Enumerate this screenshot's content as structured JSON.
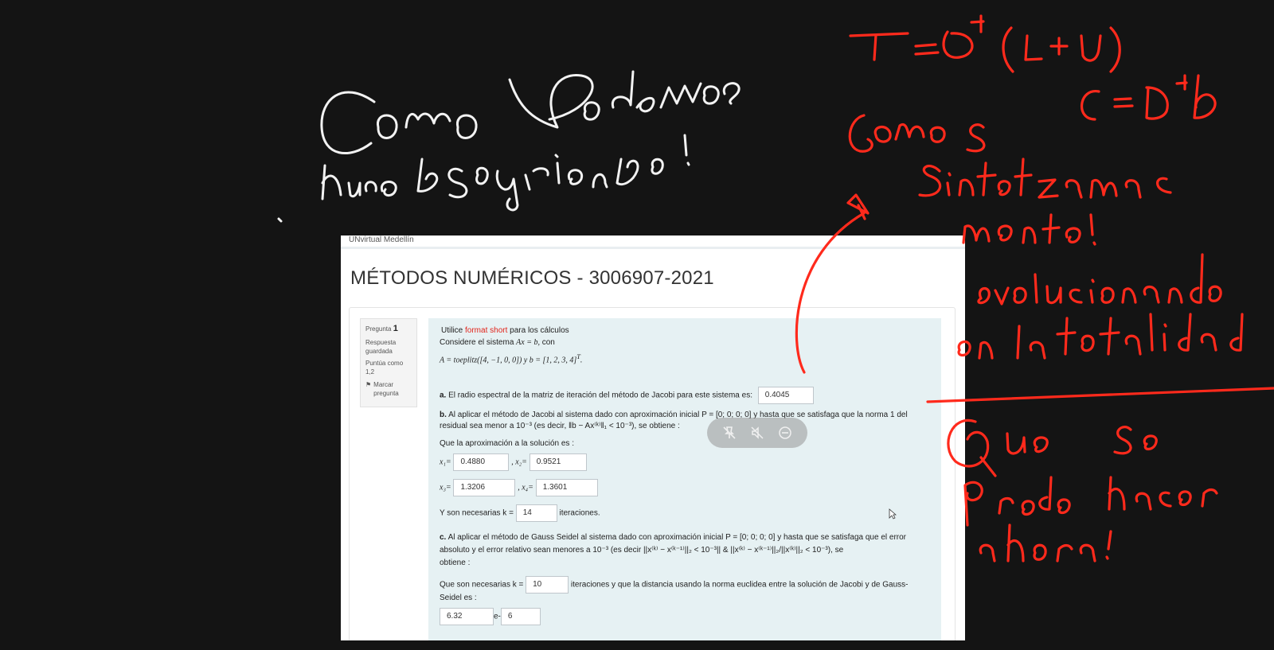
{
  "site_name": "UNvirtual Medellín",
  "course_title": "MÉTODOS NUMÉRICOS - 3006907-2021",
  "question_info": {
    "label": "Pregunta",
    "number": "1",
    "status": "Respuesta guardada",
    "score": "Puntúa como 1,2",
    "flag_label": "Marcar pregunta"
  },
  "question": {
    "intro_prefix": "Utilice",
    "intro_highlight": "format short",
    "intro_suffix": "para los cálculos",
    "system_prefix": "Considere el sistema",
    "system_eq": "Ax = b,",
    "system_suffix": "con",
    "matrix_text": "A = toeplitz([4,    −1,    0,    0]) y b = [1, 2, 3, 4]",
    "part_a_label": "a.",
    "part_a_text": "El radio espectral de la matriz de iteración del método de Jacobi para este sistema es:",
    "part_a_value": "0.4045",
    "part_b_label": "b.",
    "part_b_text1": "Al aplicar el método de Jacobi al sistema dado con aproximación inicial P = [0; 0; 0; 0] y hasta que se satisfaga que la norma 1 del",
    "part_b_text2": "residual sea menor a 10⁻³ (es decir, ‖b − Ax⁽ᵏ⁾‖₁ < 10⁻³), se obtiene :",
    "approx_label": "Que la aproximación a la solución es :",
    "x1_label": "x₁=",
    "x1_value": "0.4880",
    "x2_label": ", x₂=",
    "x2_value": "0.9521",
    "x3_label": "x₃=",
    "x3_value": "1.3206",
    "x4_label": ", x₄=",
    "x4_value": "1.3601",
    "k_prefix": "Y son necesarias k =",
    "k_value": "14",
    "k_suffix": "iteraciones.",
    "part_c_label": "c.",
    "part_c_text1": "Al aplicar el método de Gauss Seidel al sistema dado con aproximación inicial P = [0; 0; 0; 0] y hasta que se satisfaga que el error",
    "part_c_text2": "absoluto y el error relativo sean menores a 10⁻³ (es decir ||x⁽ᵏ⁾ − x⁽ᵏ⁻¹⁾||₂ < 10⁻³|| & ||x⁽ᵏ⁾ − x⁽ᵏ⁻¹⁾||₂/||x⁽ᵏ⁾||₂ < 10⁻³), se",
    "part_c_text3": "obtiene :",
    "gs_k_prefix": "Que son necesarias k =",
    "gs_k_value": "10",
    "gs_k_suffix": "iteraciones y que la distancia usando la norma euclidea entre la solución de Jacobi y de Gauss-",
    "gs_k_suffix2": "Seidel es :",
    "dist_mantissa": "6.32",
    "dist_e": "e-",
    "dist_exp": "6"
  },
  "annotations": {
    "white_note_line1": "Como Podemos",
    "white_note_line2": "hacer lo siguiente!",
    "red_formula": "T = D⁻¹(L+U)",
    "red_line2": "Como se   C = D⁻¹b",
    "red_line3": "sintetizamos",
    "red_line4": "mente!",
    "red_line5": "evolucionando",
    "red_line6": "en la totalidad",
    "red_line7": "Que se",
    "red_line8": "puede hacer",
    "red_line9": "ahora!"
  },
  "toolbar": {
    "icons": [
      "pin-off-icon",
      "mute-icon",
      "minimize-icon"
    ]
  },
  "colors": {
    "ink_red": "#ff2a1c",
    "ink_white": "#f2f2f2",
    "background": "#141414",
    "question_bg": "#e6f1f3",
    "highlight_red": "#e2231a"
  }
}
